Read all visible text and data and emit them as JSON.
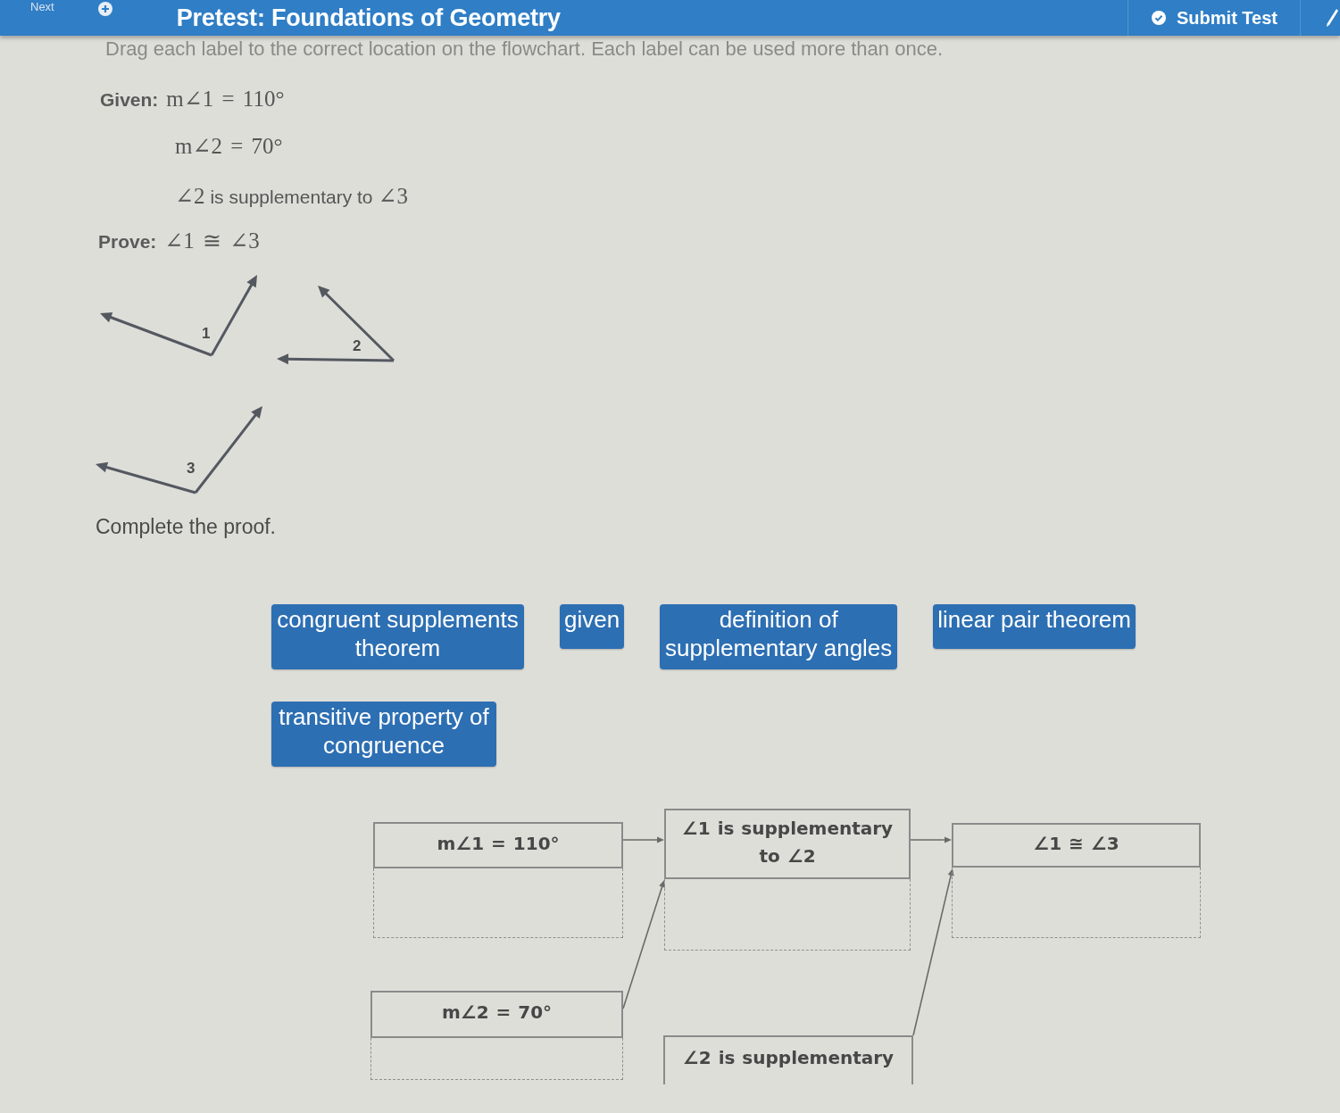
{
  "header": {
    "next_label": "Next",
    "title": "Pretest: Foundations of Geometry",
    "submit_label": "Submit Test"
  },
  "instructions": "Drag each label to the correct location on the flowchart. Each label can be used more than once.",
  "given": {
    "label": "Given:",
    "statements": [
      {
        "parts": [
          {
            "kind": "math",
            "text": "m∠1 = 110°"
          }
        ]
      },
      {
        "parts": [
          {
            "kind": "math",
            "text": "m∠2 = 70°"
          }
        ]
      },
      {
        "parts": [
          {
            "kind": "math",
            "text": "∠2"
          },
          {
            "kind": "text",
            "text": "is supplementary to"
          },
          {
            "kind": "math",
            "text": "∠3"
          }
        ]
      }
    ]
  },
  "prove": {
    "label": "Prove:",
    "parts": [
      {
        "kind": "math",
        "text": "∠1 ≅ ∠3"
      }
    ]
  },
  "figure": {
    "angles": [
      {
        "label": "1"
      },
      {
        "label": "2"
      },
      {
        "label": "3"
      }
    ]
  },
  "prompt": "Complete the proof.",
  "labels": [
    {
      "text": "congruent supplements theorem"
    },
    {
      "text": "given"
    },
    {
      "text": "definition of supplementary angles"
    },
    {
      "text": "linear pair theorem"
    },
    {
      "text": "transitive property of congruence"
    }
  ],
  "flowchart": {
    "nodes": [
      {
        "statement": "m∠1 = 110°",
        "drop_zone": true
      },
      {
        "statement": "∠1 is supplementary to ∠2",
        "drop_zone": true
      },
      {
        "statement": "∠1 ≅ ∠3",
        "drop_zone": true
      },
      {
        "statement": "m∠2 = 70°",
        "drop_zone": true
      },
      {
        "statement": "∠2 is supplementary",
        "drop_zone": false
      }
    ]
  }
}
